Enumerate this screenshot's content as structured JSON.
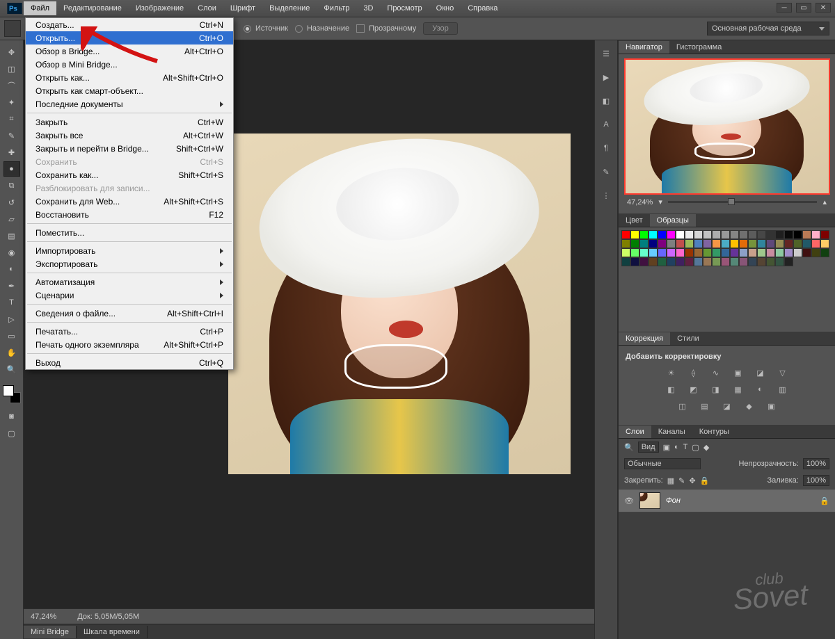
{
  "menubar": {
    "items": [
      "Файл",
      "Редактирование",
      "Изображение",
      "Слои",
      "Шрифт",
      "Выделение",
      "Фильтр",
      "3D",
      "Просмотр",
      "Окно",
      "Справка"
    ]
  },
  "file_menu": {
    "r0": {
      "label": "Создать...",
      "short": "Ctrl+N"
    },
    "r1": {
      "label": "Открыть...",
      "short": "Ctrl+O"
    },
    "r2": {
      "label": "Обзор в Bridge...",
      "short": "Alt+Ctrl+O"
    },
    "r3": {
      "label": "Обзор в Mini Bridge..."
    },
    "r4": {
      "label": "Открыть как...",
      "short": "Alt+Shift+Ctrl+O"
    },
    "r5": {
      "label": "Открыть как смарт-объект..."
    },
    "r6": {
      "label": "Последние документы"
    },
    "r7": {
      "label": "Закрыть",
      "short": "Ctrl+W"
    },
    "r8": {
      "label": "Закрыть все",
      "short": "Alt+Ctrl+W"
    },
    "r9": {
      "label": "Закрыть и перейти в Bridge...",
      "short": "Shift+Ctrl+W"
    },
    "r10": {
      "label": "Сохранить",
      "short": "Ctrl+S"
    },
    "r11": {
      "label": "Сохранить как...",
      "short": "Shift+Ctrl+S"
    },
    "r12": {
      "label": "Разблокировать для записи..."
    },
    "r13": {
      "label": "Сохранить для Web...",
      "short": "Alt+Shift+Ctrl+S"
    },
    "r14": {
      "label": "Восстановить",
      "short": "F12"
    },
    "r15": {
      "label": "Поместить..."
    },
    "r16": {
      "label": "Импортировать"
    },
    "r17": {
      "label": "Экспортировать"
    },
    "r18": {
      "label": "Автоматизация"
    },
    "r19": {
      "label": "Сценарии"
    },
    "r20": {
      "label": "Сведения о файле...",
      "short": "Alt+Shift+Ctrl+I"
    },
    "r21": {
      "label": "Печатать...",
      "short": "Ctrl+P"
    },
    "r22": {
      "label": "Печать одного экземпляра",
      "short": "Alt+Shift+Ctrl+P"
    },
    "r23": {
      "label": "Выход",
      "short": "Ctrl+Q"
    }
  },
  "optbar": {
    "source": "Источник",
    "dest": "Назначение",
    "transp": "Прозрачному",
    "pattern": "Узор"
  },
  "workspace_label": "Основная рабочая среда",
  "panels": {
    "nav_tab": "Навигатор",
    "hist_tab": "Гистограмма",
    "zoom": "47,24%",
    "color_tab": "Цвет",
    "swatch_tab": "Образцы",
    "adj_tab": "Коррекция",
    "styles_tab": "Стили",
    "adj_hdr": "Добавить корректировку",
    "layers_tab": "Слои",
    "channels_tab": "Каналы",
    "paths_tab": "Контуры",
    "kind": "Вид",
    "blend": "Обычные",
    "opacity_lbl": "Непрозрачность:",
    "opacity_val": "100%",
    "lock_lbl": "Закрепить:",
    "fill_lbl": "Заливка:",
    "fill_val": "100%",
    "layer_name": "Фон"
  },
  "status": {
    "zoom": "47,24%",
    "doc": "Док: 5,05M/5,05M"
  },
  "bottom_tabs": {
    "t1": "Mini Bridge",
    "t2": "Шкала времени"
  },
  "watermark": {
    "top": "club",
    "bottom": "Sovet"
  },
  "swatch_colors": [
    "#ff0000",
    "#ffff00",
    "#00ff00",
    "#00ffff",
    "#0000ff",
    "#ff00ff",
    "#ffffff",
    "#ebebeb",
    "#d6d6d6",
    "#c2c2c2",
    "#adadad",
    "#999999",
    "#858585",
    "#707070",
    "#5c5c5c",
    "#474747",
    "#333333",
    "#1f1f1f",
    "#0a0a0a",
    "#000000",
    "#b97a56",
    "#ffaec9",
    "#7f0000",
    "#7f7f00",
    "#007f00",
    "#007f7f",
    "#00007f",
    "#7f007f",
    "#7f7f7f",
    "#c0504d",
    "#9bbb59",
    "#4f81bd",
    "#8064a2",
    "#f79646",
    "#4bacc6",
    "#ffc000",
    "#e46c0a",
    "#76933c",
    "#31859c",
    "#5f497a",
    "#948a54",
    "#632523",
    "#4f6228",
    "#215968",
    "#ff6666",
    "#ffcc66",
    "#ccff66",
    "#66ff66",
    "#66ffcc",
    "#66ccff",
    "#6666ff",
    "#cc66ff",
    "#ff66cc",
    "#993300",
    "#996633",
    "#669933",
    "#339966",
    "#336699",
    "#663399",
    "#8ca0c8",
    "#c8a08c",
    "#a0c88c",
    "#c88ca0",
    "#8cc8a0",
    "#a08cc8",
    "#cccccc",
    "#401010",
    "#404010",
    "#104010",
    "#104040",
    "#101040",
    "#401040",
    "#604020",
    "#206040",
    "#204060",
    "#402060",
    "#602040",
    "#557799",
    "#997755",
    "#779955",
    "#995577",
    "#558877",
    "#885577",
    "#334455",
    "#554433",
    "#445533",
    "#335544",
    "#222222"
  ]
}
